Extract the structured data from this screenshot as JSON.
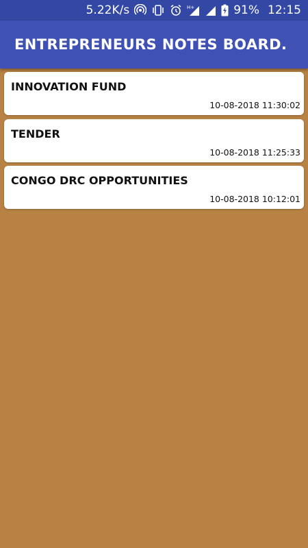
{
  "status_bar": {
    "network_speed": "5.22K/s",
    "battery_percent": "91%",
    "time": "12:15",
    "icons": [
      "hotspot-icon",
      "vibrate-icon",
      "alarm-icon",
      "signal-hplus-icon",
      "signal-icon",
      "battery-charging-icon"
    ]
  },
  "app_bar": {
    "title": "ENTREPRENEURS NOTES BOARD."
  },
  "notes": [
    {
      "title": "INNOVATION FUND",
      "timestamp": "10-08-2018 11:30:02"
    },
    {
      "title": "TENDER",
      "timestamp": "10-08-2018 11:25:33"
    },
    {
      "title": "CONGO DRC OPPORTUNITIES",
      "timestamp": "10-08-2018 10:12:01"
    }
  ],
  "colors": {
    "status_bar": "#3348a5",
    "app_bar": "#3f51b5",
    "background": "#b78243",
    "card": "#ffffff"
  }
}
